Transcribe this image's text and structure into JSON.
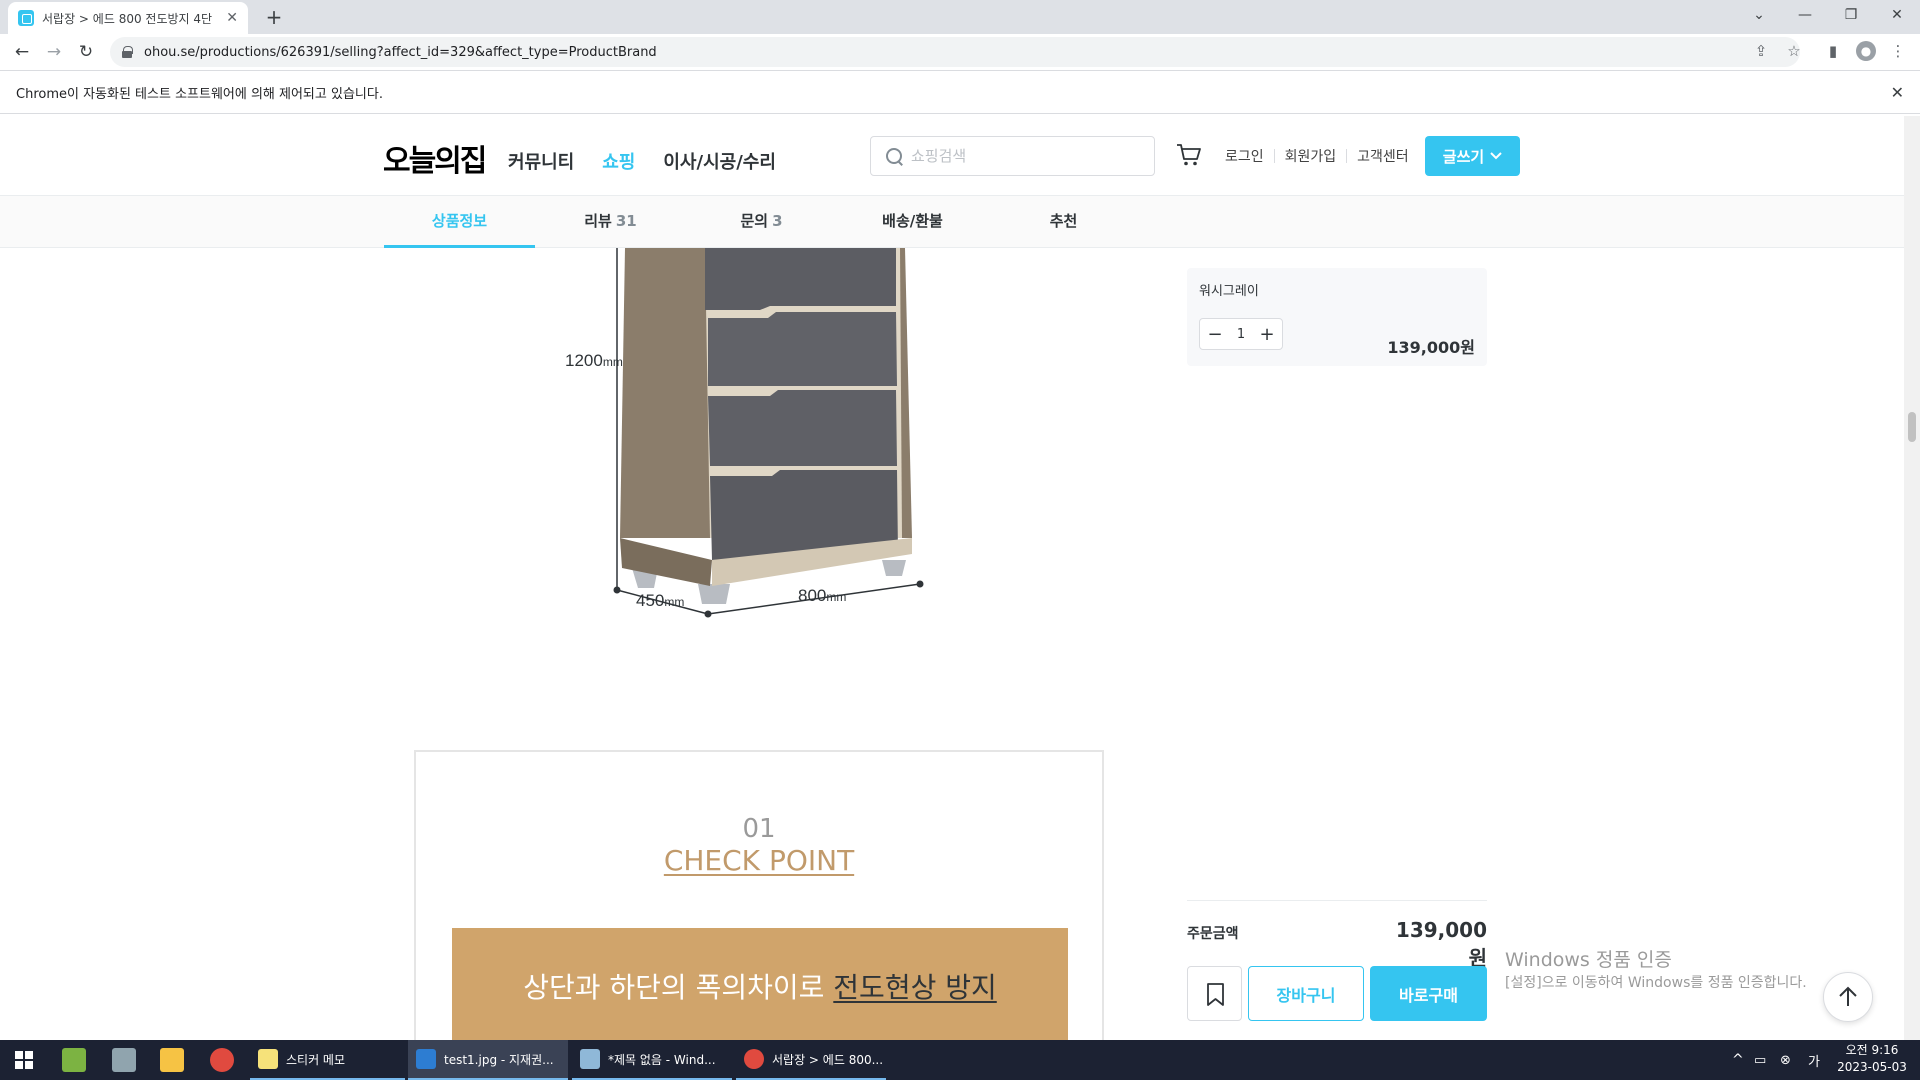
{
  "browser": {
    "tab_title": "서랍장 > 에드 800 전도방지 4단",
    "url": "ohou.se/productions/626391/selling?affect_id=329&affect_type=ProductBrand",
    "infobar_text": "Chrome이 자동화된 테스트 소프트웨어에 의해 제어되고 있습니다."
  },
  "site": {
    "logo": "오늘의집",
    "nav": [
      "커뮤니티",
      "쇼핑",
      "이사/시공/수리"
    ],
    "search_placeholder": "쇼핑검색",
    "userlinks": [
      "로그인",
      "회원가입",
      "고객센터"
    ],
    "write_label": "글쓰기",
    "accent": "#35c5f0"
  },
  "subnav": {
    "tabs": [
      {
        "label": "상품정보",
        "count": ""
      },
      {
        "label": "리뷰",
        "count": "31"
      },
      {
        "label": "문의",
        "count": "3"
      },
      {
        "label": "배송/환불",
        "count": ""
      },
      {
        "label": "추천",
        "count": ""
      }
    ]
  },
  "product_image": {
    "height_label": "1200",
    "depth_label": "450",
    "width_label": "800",
    "unit": "mm"
  },
  "checkpoint": {
    "number": "01",
    "title": "CHECK POINT",
    "band_text_plain": "상단과 하단의 폭의차이로 ",
    "band_text_emph": "전도현상 방지"
  },
  "order": {
    "option_name": "워시그레이",
    "quantity": "1",
    "option_price": "139,000원",
    "total_label": "주문금액",
    "total_price": "139,000원",
    "cart_label": "장바구니",
    "buy_label": "바로구매"
  },
  "watermark": {
    "line1": "Windows 정품 인증",
    "line2": "[설정]으로 이동하여 Windows를 정품 인증합니다."
  },
  "taskbar": {
    "apps": [
      "스티커 메모",
      "test1.jpg - 지재권...",
      "*제목 없음 - Wind...",
      "서랍장 > 에드 800..."
    ],
    "time": "오전 9:16",
    "date": "2023-05-03"
  }
}
